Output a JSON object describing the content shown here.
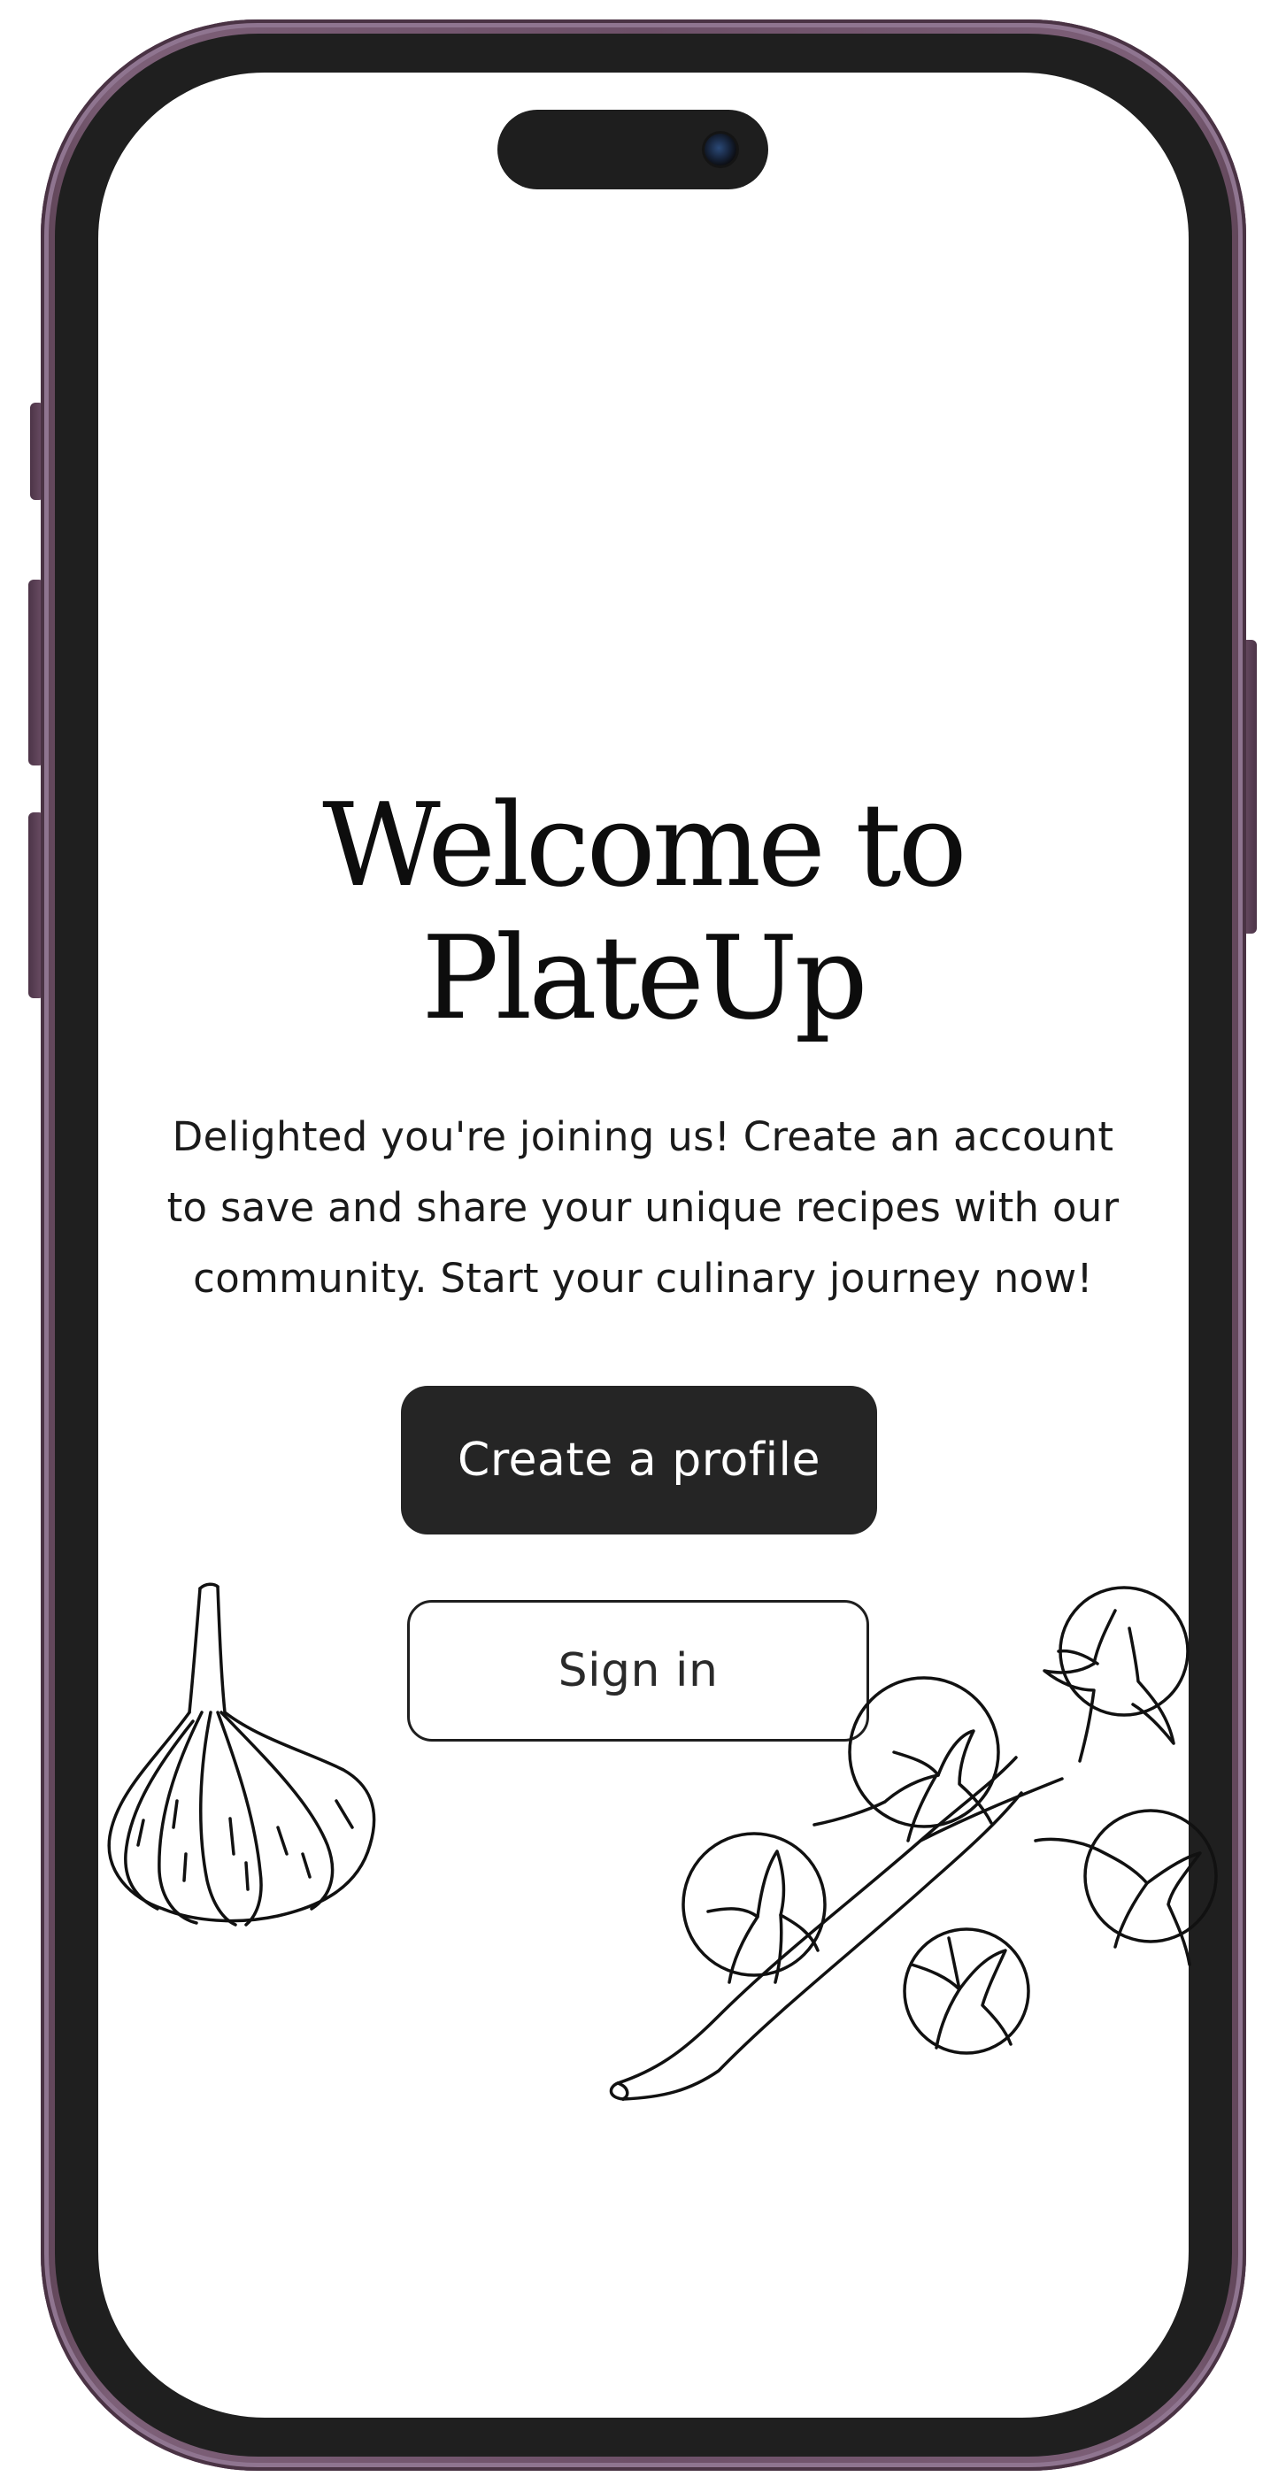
{
  "screen": {
    "title_line1": "Welcome to",
    "title_line2": "PlateUp",
    "description_line1": "Delighted you're joining us! Create an account",
    "description_line2": "to save and share your unique recipes with our",
    "description_line3": "community. Start your culinary journey now!",
    "primary_button_label": "Create a profile",
    "secondary_button_label": "Sign in"
  },
  "icons": {
    "garlic": "garlic-illustration",
    "tomatoes": "cherry-tomato-vine-illustration",
    "camera": "front-camera"
  },
  "colors": {
    "phone_frame": "#6d5068",
    "bezel": "#1f1f1f",
    "screen_background": "#ffffff",
    "primary_button_background": "#252525",
    "primary_button_text": "#ffffff",
    "text": "#0d0d0d"
  }
}
